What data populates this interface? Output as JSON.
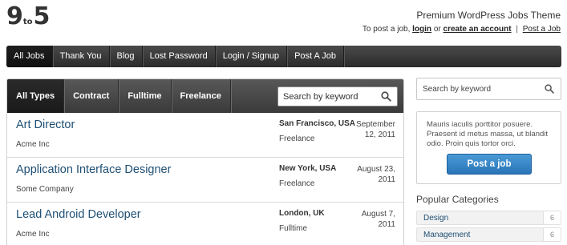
{
  "logo": {
    "left": "9",
    "middle": "to",
    "right": "5"
  },
  "tagline": "Premium WordPress Jobs Theme",
  "toplinks": {
    "prefix": "To post a job,",
    "login": "login",
    "or": "or",
    "create_account": "create an account",
    "separator": "|",
    "post_job": "Post a Job"
  },
  "mainnav": [
    "All Jobs",
    "Thank You",
    "Blog",
    "Lost Password",
    "Login / Signup",
    "Post A Job"
  ],
  "filters": {
    "tabs": [
      "All Types",
      "Contract",
      "Fulltime",
      "Freelance"
    ],
    "search_placeholder": "Search by keyword"
  },
  "jobs": [
    {
      "title": "Art Director",
      "company": "Acme Inc",
      "location": "San Francisco, USA",
      "type": "Freelance",
      "date": "September 12, 2011"
    },
    {
      "title": "Application Interface Designer",
      "company": "Some Company",
      "location": "New York, USA",
      "type": "Freelance",
      "date": "August 23, 2011"
    },
    {
      "title": "Lead Android Developer",
      "company": "Acme Inc",
      "location": "London, UK",
      "type": "Fulltime",
      "date": "August 7, 2011"
    }
  ],
  "sidebar": {
    "search_placeholder": "Search by keyword",
    "promo_text": "Mauris iaculis porttitor posuere. Praesent id metus massa, ut blandit odio. Proin quis tortor orci.",
    "promo_button": "Post a job",
    "categories_heading": "Popular Categories",
    "categories": [
      {
        "name": "Design",
        "count": "6"
      },
      {
        "name": "Management",
        "count": "6"
      }
    ]
  },
  "colors": {
    "nav_dark": "#2b2b2b",
    "link_blue": "#1e4f74",
    "button_blue": "#2a75b8"
  },
  "icons": {
    "search": "search-icon"
  }
}
